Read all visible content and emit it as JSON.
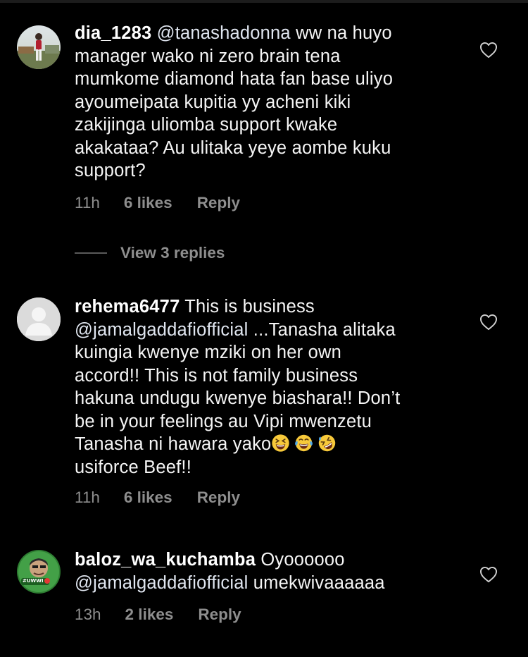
{
  "comments": [
    {
      "username": "dia_1283",
      "mention": "@tanashadonna",
      "text_lines": [
        "ww na huyo",
        "manager wako ni zero brain tena",
        "mumkome diamond hata fan base uliyo",
        "ayoumeipata kupitia yy acheni kiki",
        "zakijinga uliomba support kwake",
        "akakataa? Au ulitaka yeye aombe kuku",
        "support?"
      ],
      "time": "11h",
      "likes": "6 likes",
      "reply": "Reply",
      "avatar": "photo-person-outdoors"
    },
    {
      "username": "rehema6477",
      "first_text": "This is business",
      "mention": "@jamalgaddafiofficial",
      "mention_after": "...Tanasha alitaka",
      "text_lines": [
        "kuingia kwenye mziki on her own",
        "accord!! This is not family business",
        "hakuna undugu kwenye biashara!! Don’t",
        "be in your feelings au Vipi mwenzetu"
      ],
      "line_before_emoji": "Tanasha ni hawara yako",
      "emojis": [
        "grinning-squinting-face",
        "face-with-tears-of-joy",
        "rolling-on-floor-laughing"
      ],
      "last_line": "usiforce Beef!!",
      "time": "11h",
      "likes": "6 likes",
      "reply": "Reply",
      "avatar": "default-avatar"
    },
    {
      "username": "baloz_wa_kuchamba",
      "first_text": "Oyoooooo",
      "mention": "@jamalgaddafiofficial",
      "mention_after": "umekwivaaaaaa",
      "time": "13h",
      "likes": "2 likes",
      "reply": "Reply",
      "avatar": "green-badge-avatar",
      "avatar_badge": "#UWWI"
    }
  ],
  "view_replies": "View 3 replies",
  "colors": {
    "background": "#000000",
    "text": "#f5f5f5",
    "meta": "#8e8e8e"
  }
}
